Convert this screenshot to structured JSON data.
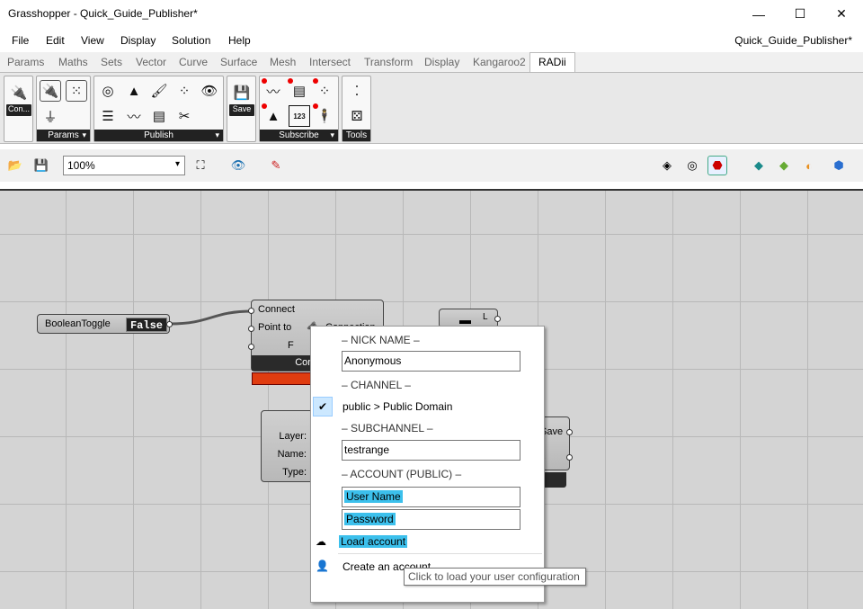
{
  "window": {
    "title": "Grasshopper - Quick_Guide_Publisher*",
    "minimize": "—",
    "maximize": "☐",
    "close": "✕"
  },
  "menu": {
    "items": [
      "File",
      "Edit",
      "View",
      "Display",
      "Solution",
      "Help"
    ],
    "document": "Quick_Guide_Publisher*"
  },
  "tabs": [
    "Params",
    "Maths",
    "Sets",
    "Vector",
    "Curve",
    "Surface",
    "Mesh",
    "Intersect",
    "Transform",
    "Display",
    "Kangaroo2",
    "RADii"
  ],
  "ribbon": {
    "groups": {
      "con": "Con...",
      "params": "Params",
      "publish": "Publish",
      "save": "Save",
      "subscribe": "Subscribe",
      "tools": "Tools"
    },
    "num_badge": "123"
  },
  "toolbar": {
    "zoom": "100%"
  },
  "canvas": {
    "boolean_toggle": {
      "label": "BooleanToggle",
      "value": "False"
    },
    "publisher": {
      "inputs": [
        "Connect",
        "Point to",
        "F"
      ],
      "footer": "Config loa",
      "overflow": "Connection"
    },
    "subscriber": {
      "inputs": [
        "Layer:",
        "Name:",
        "Type:"
      ]
    },
    "right_comp": {
      "inputs": [
        "Save",
        "s"
      ]
    },
    "small_comp": {
      "label": "L"
    }
  },
  "context_menu": {
    "nick_header": "– NICK NAME –",
    "nick_value": "Anonymous",
    "channel_header": "– CHANNEL –",
    "channel_value": "public > Public Domain",
    "subchannel_header": "– SUBCHANNEL –",
    "subchannel_value": "testrange",
    "account_header": "– ACCOUNT (PUBLIC) –",
    "username_placeholder": "User Name",
    "password_placeholder": "Password",
    "load_account": "Load account",
    "create_account": "Create an account"
  },
  "tooltip": "Click to load your user configuration",
  "colors": {
    "highlight": "#3cc0ec",
    "error": "#e03c10",
    "canvas": "#d4d4d4"
  }
}
